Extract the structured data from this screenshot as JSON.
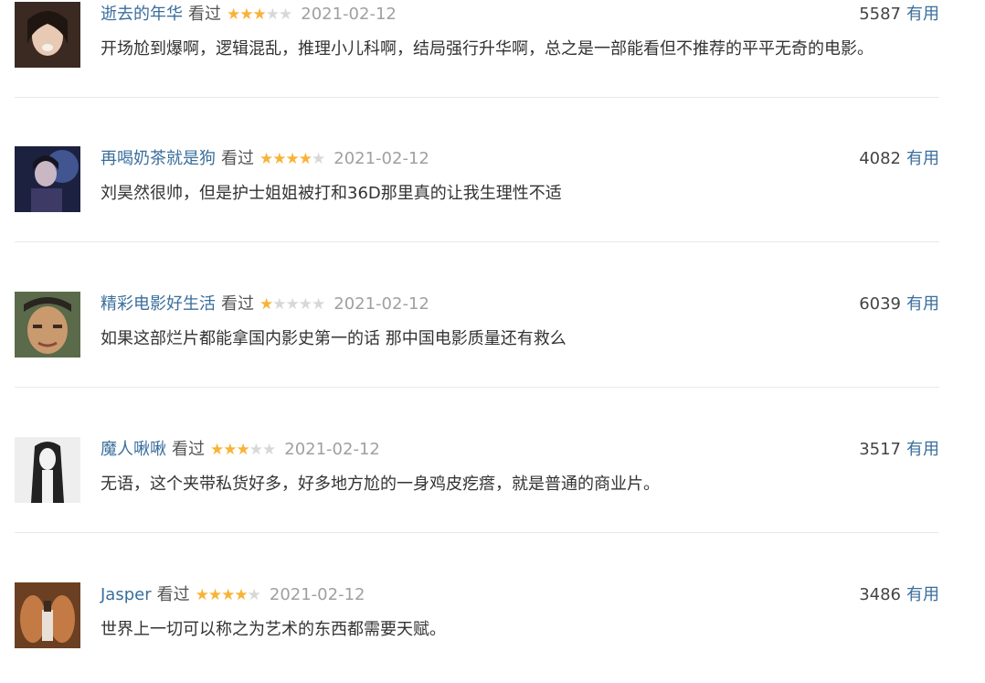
{
  "reviews": [
    {
      "username": "逝去的年华",
      "status": "看过",
      "rating": 3,
      "date": "2021-02-12",
      "votes": "5587",
      "useful_label": "有用",
      "content": "开场尬到爆啊，逻辑混乱，推理小儿科啊，结局强行升华啊，总之是一部能看但不推荐的平平无奇的电影。"
    },
    {
      "username": "再喝奶茶就是狗",
      "status": "看过",
      "rating": 4,
      "date": "2021-02-12",
      "votes": "4082",
      "useful_label": "有用",
      "content": "刘昊然很帅，但是护士姐姐被打和36D那里真的让我生理性不适"
    },
    {
      "username": "精彩电影好生活",
      "status": "看过",
      "rating": 1,
      "date": "2021-02-12",
      "votes": "6039",
      "useful_label": "有用",
      "content": "如果这部烂片都能拿国内影史第一的话 那中国电影质量还有救么"
    },
    {
      "username": "魔人啾啾",
      "status": "看过",
      "rating": 3,
      "date": "2021-02-12",
      "votes": "3517",
      "useful_label": "有用",
      "content": "无语，这个夹带私货好多，好多地方尬的一身鸡皮疙瘩，就是普通的商业片。"
    },
    {
      "username": "Jasper",
      "status": "看过",
      "rating": 4,
      "date": "2021-02-12",
      "votes": "3486",
      "useful_label": "有用",
      "content": "世界上一切可以称之为艺术的东西都需要天赋。"
    }
  ],
  "rating_max": 5,
  "colors": {
    "link": "#3a6e9c",
    "star_filled": "#f8b336",
    "star_empty": "#d8d8d8",
    "date": "#a0a0a0"
  }
}
